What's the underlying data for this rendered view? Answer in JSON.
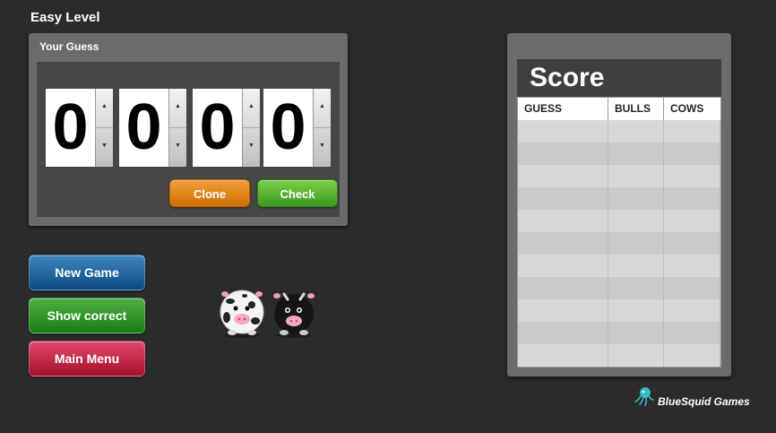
{
  "level_title": "Easy Level",
  "guess_panel": {
    "title": "Your Guess",
    "digits": [
      "0",
      "0",
      "0",
      "0"
    ],
    "clone_label": "Clone",
    "check_label": "Check"
  },
  "menu": {
    "new_game": "New Game",
    "show_correct": "Show correct",
    "main_menu": "Main Menu"
  },
  "score": {
    "title": "Score",
    "columns": [
      "GUESS",
      "BULLS",
      "COWS"
    ],
    "rows": [
      [
        "",
        "",
        ""
      ],
      [
        "",
        "",
        ""
      ],
      [
        "",
        "",
        ""
      ],
      [
        "",
        "",
        ""
      ],
      [
        "",
        "",
        ""
      ],
      [
        "",
        "",
        ""
      ],
      [
        "",
        "",
        ""
      ],
      [
        "",
        "",
        ""
      ],
      [
        "",
        "",
        ""
      ],
      [
        "",
        "",
        ""
      ],
      [
        "",
        "",
        ""
      ]
    ]
  },
  "brand": {
    "name": "BlueSquid Games",
    "icon": "squid-icon"
  },
  "colors": {
    "background": "#2b2b2b",
    "clone": "#e8860f",
    "check": "#5bb534",
    "new_game": "#1f65a3",
    "show_correct": "#33952a",
    "main_menu": "#c8234a"
  }
}
